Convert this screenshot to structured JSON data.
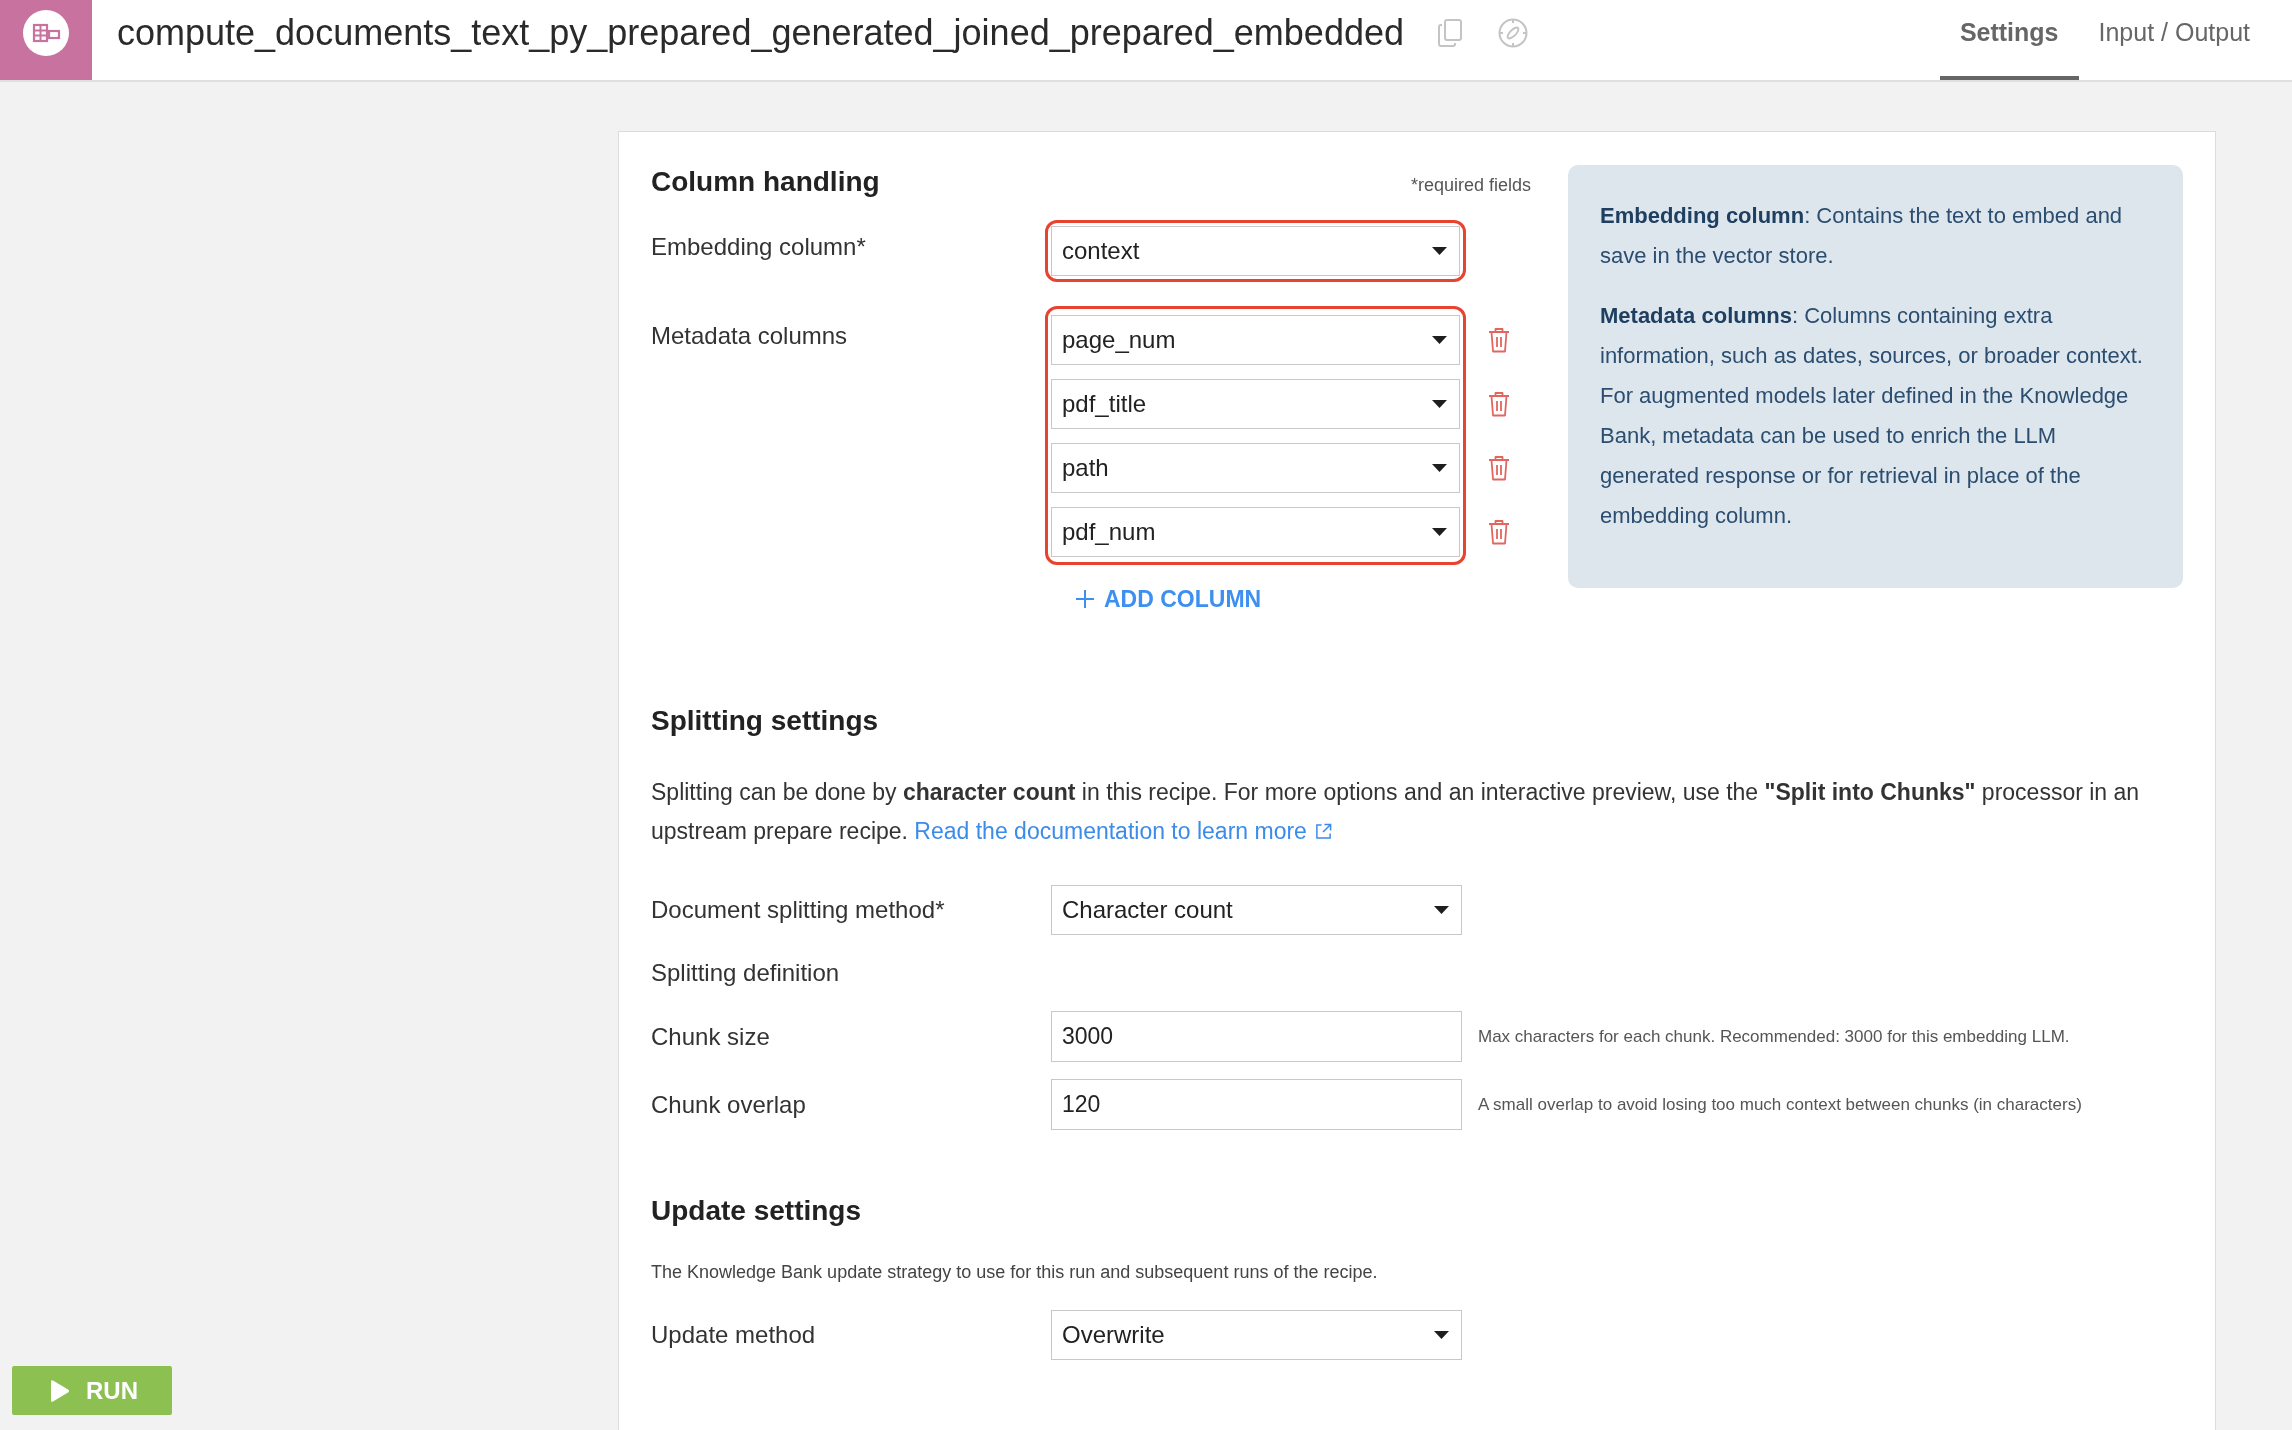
{
  "app_bar": {
    "title": "compute_documents_text_py_prepared_generated_joined_prepared_embedded",
    "tabs": [
      {
        "label": "Settings",
        "selected": true
      },
      {
        "label": "Input / Output",
        "selected": false
      }
    ]
  },
  "column_handling": {
    "title": "Column handling",
    "required_note": "*required fields",
    "embedding_column": {
      "label": "Embedding column*",
      "value": "context",
      "highlighted": true
    },
    "metadata_columns": {
      "label": "Metadata columns",
      "highlighted": true,
      "values": [
        "page_num",
        "pdf_title",
        "path",
        "pdf_num"
      ]
    },
    "add_button": "ADD COLUMN"
  },
  "help_panel": {
    "paragraphs": [
      "**Embedding column**: Contains the text to embed and save in the vector store.",
      "**Metadata columns**: Columns containing extra information, such as dates, sources, or broader context. For augmented models later defined in the Knowledge Bank, metadata can be used to enrich the LLM generated response or for retrieval in place of the embedding column."
    ]
  },
  "splitting_settings": {
    "title": "Splitting settings",
    "description": "Splitting can be done by **character count** in this recipe. For more options and an interactive preview, use the **\"Split into Chunks\"** processor in an upstream prepare recipe.",
    "link": "Read the documentation to learn more",
    "method": {
      "label": "Document splitting method*",
      "value": "Character count"
    },
    "definition_title": "Splitting definition",
    "fields": [
      {
        "label": "Chunk size",
        "value": "3000",
        "hint": "Max characters for each chunk. Recommended: 3000 for this embedding LLM."
      },
      {
        "label": "Chunk overlap",
        "value": "120",
        "hint": "A small overlap to avoid losing too much context between chunks (in characters)"
      }
    ]
  },
  "update_settings": {
    "title": "Update settings",
    "description": "The Knowledge Bank update strategy to use for this run and subsequent runs of the recipe.",
    "method": {
      "label": "Update method",
      "value": "Overwrite"
    }
  },
  "run_button": "RUN"
}
